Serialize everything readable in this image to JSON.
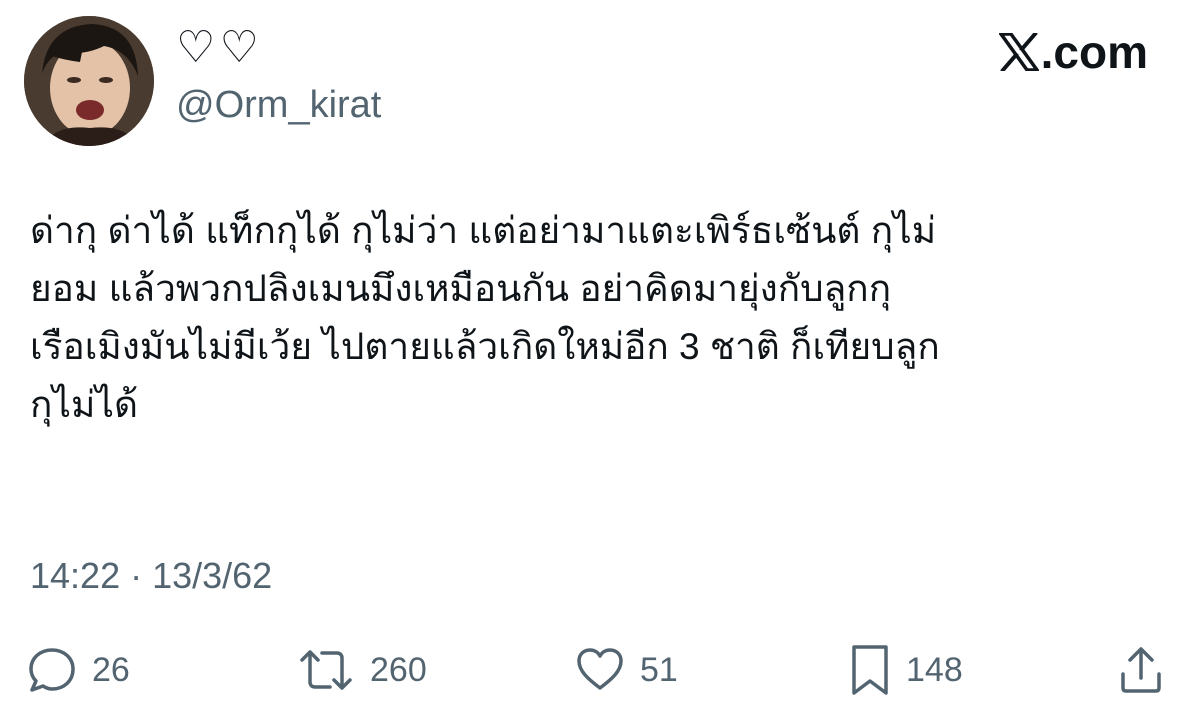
{
  "header": {
    "display_name": "♡♡",
    "handle": "@Orm_kirat",
    "brand": ".com",
    "brand_icon": "x-logo-icon"
  },
  "tweet": {
    "text": "ด่ากุ ด่าได้ แท็กกุได้ กุไม่ว่า แต่อย่ามาแตะเพิร์ธเซ้นต์ กุไม่\nยอม แล้วพวกปลิงเมนมึงเหมือนกัน อย่าคิดมายุ่งกับลูกกุ\nเรือเมิงมันไม่มีเว้ย ไปตายแล้วเกิดใหม่อีก 3 ชาติ ก็เทียบลูก\nกุไม่ได้",
    "timestamp": "14:22 · 13/3/62"
  },
  "actions": {
    "reply": {
      "icon": "reply-icon",
      "count": "26"
    },
    "retweet": {
      "icon": "retweet-icon",
      "count": "260"
    },
    "like": {
      "icon": "heart-icon",
      "count": "51"
    },
    "bookmark": {
      "icon": "bookmark-icon",
      "count": "148"
    },
    "share": {
      "icon": "share-icon"
    }
  },
  "colors": {
    "primary_text": "#0f1419",
    "secondary_text": "#536471",
    "background": "#ffffff"
  }
}
